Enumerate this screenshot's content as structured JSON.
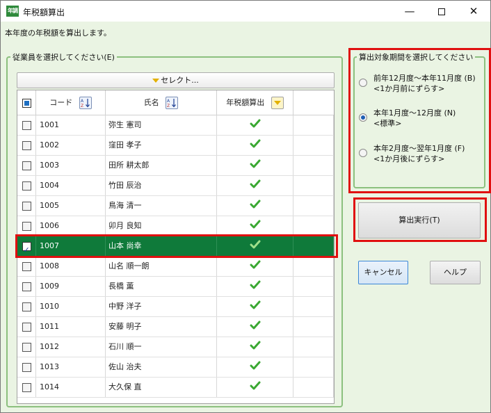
{
  "window": {
    "icon_text": "年調",
    "title": "年税額算出",
    "minimize": "—",
    "close": "✕"
  },
  "description": "本年度の年税額を算出します。",
  "employee_group": {
    "legend": "従業員を選択してください(E)",
    "select_button": "セレクト...",
    "columns": {
      "code": "コード",
      "name": "氏名",
      "calc": "年税額算出"
    },
    "rows": [
      {
        "code": "1001",
        "name": "弥生 憲司",
        "checked": false,
        "calc_done": true
      },
      {
        "code": "1002",
        "name": "窪田 孝子",
        "checked": false,
        "calc_done": true
      },
      {
        "code": "1003",
        "name": "田所 耕太郎",
        "checked": false,
        "calc_done": true
      },
      {
        "code": "1004",
        "name": "竹田 辰治",
        "checked": false,
        "calc_done": true
      },
      {
        "code": "1005",
        "name": "鳥海 清一",
        "checked": false,
        "calc_done": true
      },
      {
        "code": "1006",
        "name": "卯月 良知",
        "checked": false,
        "calc_done": true
      },
      {
        "code": "1007",
        "name": "山本 尚幸",
        "checked": true,
        "calc_done": true,
        "selected": true
      },
      {
        "code": "1008",
        "name": "山名 順一朗",
        "checked": false,
        "calc_done": true
      },
      {
        "code": "1009",
        "name": "長橋 薫",
        "checked": false,
        "calc_done": true
      },
      {
        "code": "1010",
        "name": "中野 洋子",
        "checked": false,
        "calc_done": true
      },
      {
        "code": "1011",
        "name": "安藤 明子",
        "checked": false,
        "calc_done": true
      },
      {
        "code": "1012",
        "name": "石川 順一",
        "checked": false,
        "calc_done": true
      },
      {
        "code": "1013",
        "name": "佐山 治夫",
        "checked": false,
        "calc_done": true
      },
      {
        "code": "1014",
        "name": "大久保 直",
        "checked": false,
        "calc_done": true
      }
    ]
  },
  "period_group": {
    "legend": "算出対象期間を選択してください",
    "options": [
      {
        "line1": "前年12月度～本年11月度 (B)",
        "line2": "<1か月前にずらす>",
        "selected": false
      },
      {
        "line1": "本年1月度～12月度 (N)",
        "line2": "<標準>",
        "selected": true
      },
      {
        "line1": "本年2月度～翌年1月度 (F)",
        "line2": "<1か月後にずらす>",
        "selected": false
      }
    ]
  },
  "buttons": {
    "execute": "算出実行(T)",
    "cancel": "キャンセル",
    "help": "ヘルプ"
  },
  "colors": {
    "background": "#eaf4e3",
    "group_border": "#8cc07e",
    "selected_row": "#0f7a3a",
    "highlight_outline": "#e01010",
    "check_green": "#3aa832"
  }
}
